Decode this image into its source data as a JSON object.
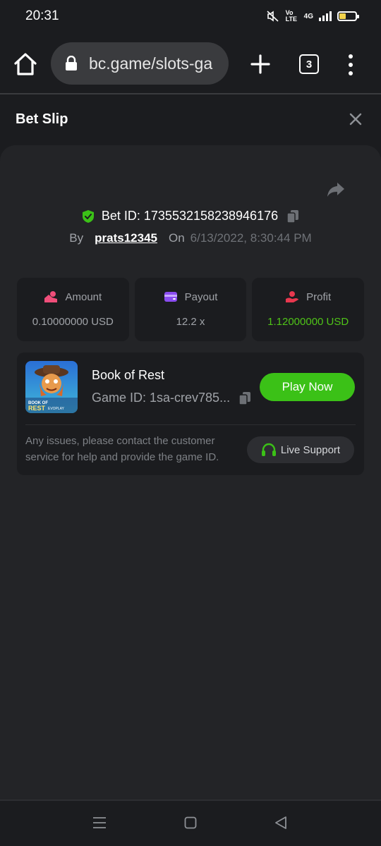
{
  "status_bar": {
    "time": "20:31",
    "network": "4G",
    "volte": "Vo LTE",
    "battery_level": 0.4
  },
  "browser": {
    "url": "bc.game/slots-ga",
    "tab_count": "3"
  },
  "bet_slip": {
    "title": "Bet Slip",
    "bet_id_label": "Bet ID: 1735532158238946176",
    "by_label": "By",
    "username": "prats12345",
    "on_label": "On",
    "date": "6/13/2022, 8:30:44 PM"
  },
  "stats": [
    {
      "label": "Amount",
      "value": "0.10000000 USD",
      "icon": "coins-icon",
      "icon_color": "#f04e7a"
    },
    {
      "label": "Payout",
      "value": "12.2 x",
      "icon": "wallet-icon",
      "icon_color": "#8a4cf0"
    },
    {
      "label": "Profit",
      "value": "1.12000000 USD",
      "icon": "profit-hand-icon",
      "icon_color": "#e8384f"
    }
  ],
  "game": {
    "title": "Book of Rest",
    "game_id": "Game ID: 1sa-crev785...",
    "play_label": "Play Now",
    "thumb_text": "BOOK OF REST",
    "thumb_brand": "EVOPLAY",
    "issues_text": "Any issues, please contact the customer service for help and provide the game ID.",
    "support_label": "Live Support"
  },
  "colors": {
    "accent_green": "#3bc117",
    "profit_green": "#4fc318",
    "panel": "#232427",
    "background": "#1b1c1f"
  }
}
